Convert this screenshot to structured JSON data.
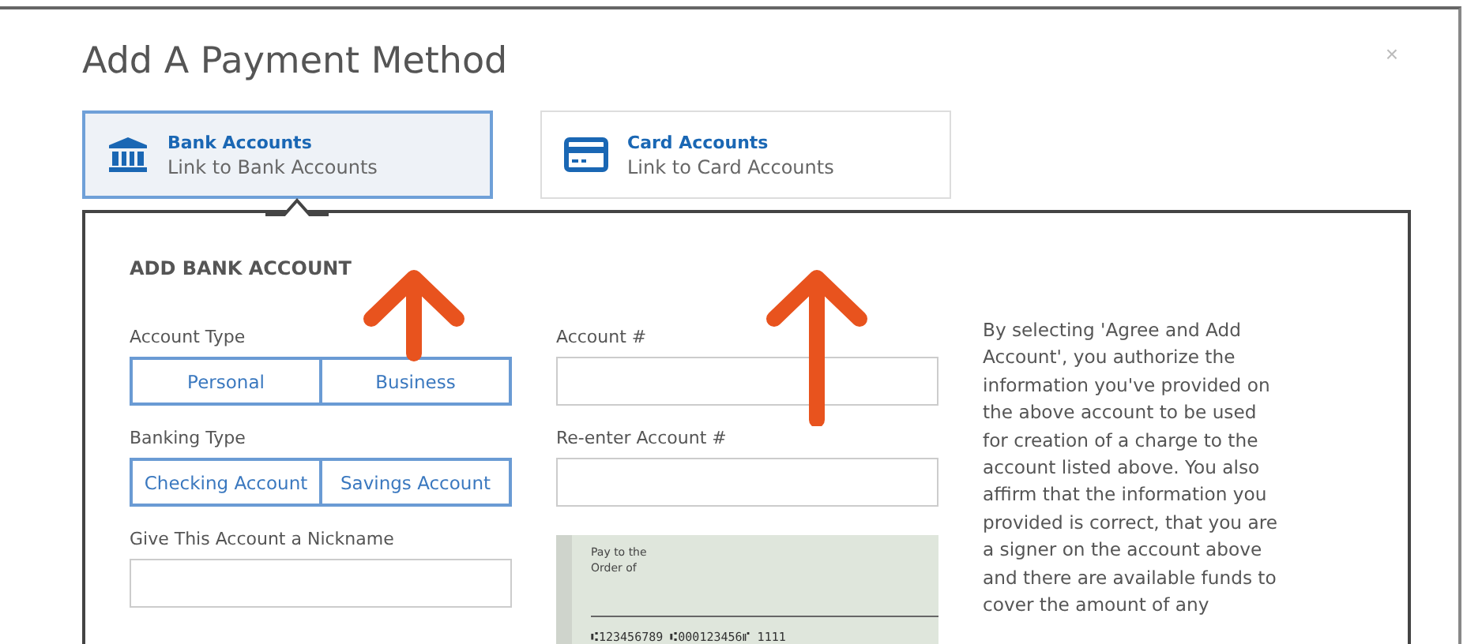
{
  "dialog": {
    "title": "Add A Payment Method",
    "close": "×"
  },
  "tabs": [
    {
      "kind": "bank",
      "title": "Bank Accounts",
      "subtitle": "Link to Bank Accounts",
      "selected": true
    },
    {
      "kind": "card",
      "title": "Card Accounts",
      "subtitle": "Link to Card Accounts",
      "selected": false
    }
  ],
  "form": {
    "heading": "ADD BANK ACCOUNT",
    "account_type": {
      "label": "Account Type",
      "options": [
        {
          "label": "Personal",
          "selected": false
        },
        {
          "label": "Business",
          "selected": false
        }
      ]
    },
    "banking_type": {
      "label": "Banking Type",
      "options": [
        {
          "label": "Checking Account",
          "selected": false
        },
        {
          "label": "Savings Account",
          "selected": false
        }
      ]
    },
    "nickname": {
      "label": "Give This Account a Nickname"
    },
    "account_number": {
      "label": "Account #"
    },
    "reenter_account_number": {
      "label": "Re-enter Account #"
    },
    "check": {
      "pay_to": "Pay to the",
      "order_of": "Order of",
      "micr": "⑆123456789 ⑆000123456⑈ 1111"
    },
    "disclaimer": "By selecting 'Agree and Add Account', you authorize the information you've provided on the above account to be used for creation of a charge to the account listed above. You also affirm that the information you provided is correct, that you are a signer on the account above and there are available funds to cover the amount of any"
  }
}
